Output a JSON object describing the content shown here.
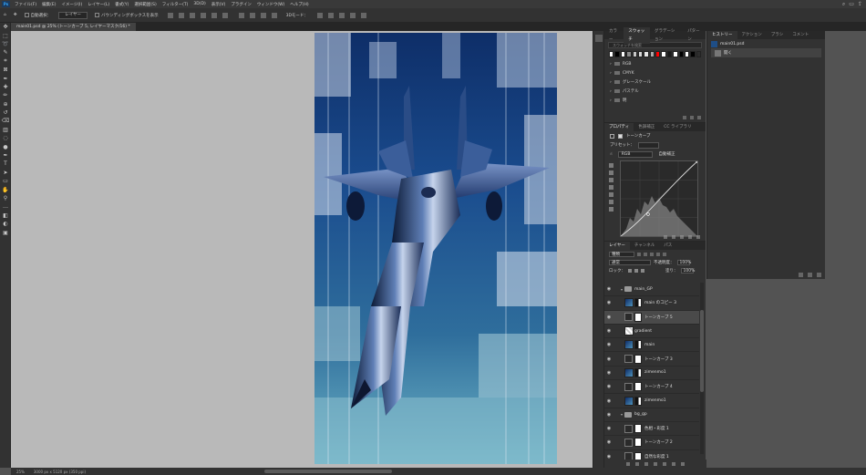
{
  "menubar": {
    "app_icon": "Ps",
    "items": [
      "ファイル(F)",
      "編集(E)",
      "イメージ(I)",
      "レイヤー(L)",
      "書式(Y)",
      "選択範囲(S)",
      "フィルター(T)",
      "3D(D)",
      "表示(V)",
      "プラグイン",
      "ウィンドウ(W)",
      "ヘルプ(H)"
    ],
    "right_icons": [
      "search-icon",
      "workspace-icon",
      "share-icon"
    ]
  },
  "options": {
    "auto_select_label": "自動選択：",
    "auto_select_value": "レイヤー",
    "bbox_label": "バウンディングボックスを表示",
    "mode_3d": "3Dモード："
  },
  "document": {
    "tab_title": "main01.psd @ 25% (トーンカーブ 5, レイヤーマスク/16) *",
    "zoom": "25%",
    "dimensions": "3000 px x 5120 px (350 ppi)"
  },
  "swatches": {
    "tabs": [
      "カラー",
      "スウォッチ",
      "グラデーション",
      "パターン"
    ],
    "active_tab": "スウォッチ",
    "search_placeholder": "スウォッチを検索",
    "colors": [
      "#ffffff",
      "#000000",
      "#ffffff",
      "#8c8c8c",
      "#c8c8c8",
      "#d7d7d7",
      "#e6e6e6",
      "#aaaaaa",
      "#ff0000",
      "#ffffff",
      "#1a1a1a",
      "#ffffff",
      "#000000",
      "#ffffff",
      "#000000",
      "#2e2e2e"
    ],
    "groups": [
      "RGB",
      "CMYK",
      "グレースケール",
      "パステル",
      "明"
    ]
  },
  "history": {
    "tabs": [
      "ヒストリー",
      "アクション",
      "ブラシ",
      "コメント"
    ],
    "active_tab": "ヒストリー",
    "snapshot": "main01.psd",
    "items": [
      "開く"
    ]
  },
  "properties": {
    "tabs": [
      "プロパティ",
      "色調補正",
      "CC ライブラリ"
    ],
    "active_tab": "プロパティ",
    "title": "トーンカーブ",
    "preset_label": "プリセット：",
    "channel": "RGB",
    "auto_button": "自動補正"
  },
  "layers": {
    "tabs": [
      "レイヤー",
      "チャンネル",
      "パス"
    ],
    "active_tab": "レイヤー",
    "filter": "種類",
    "blend_mode": "通常",
    "opacity_label": "不透明度：",
    "opacity": "100%",
    "lock_label": "ロック：",
    "fill_label": "塗り：",
    "fill": "100%",
    "list": [
      {
        "name": "main_GP",
        "kind": "group",
        "indent": 0,
        "selected": false
      },
      {
        "name": "main のコピー 3",
        "kind": "pixel",
        "indent": 1,
        "selected": false
      },
      {
        "name": "トーンカーブ 5",
        "kind": "curve",
        "indent": 1,
        "selected": true
      },
      {
        "name": "gradient",
        "kind": "grad",
        "indent": 1,
        "selected": false
      },
      {
        "name": "main",
        "kind": "pixel",
        "indent": 1,
        "selected": false
      },
      {
        "name": "トーンカーブ 3",
        "kind": "curve",
        "indent": 1,
        "selected": false
      },
      {
        "name": "zimenmo1",
        "kind": "pixel",
        "indent": 1,
        "selected": false
      },
      {
        "name": "トーンカーブ 4",
        "kind": "curve",
        "indent": 1,
        "selected": false
      },
      {
        "name": "zimenmo1",
        "kind": "pixel",
        "indent": 1,
        "selected": false
      },
      {
        "name": "bg_gp",
        "kind": "group",
        "indent": 0,
        "selected": false
      },
      {
        "name": "色相・彩度 1",
        "kind": "hue",
        "indent": 1,
        "selected": false
      },
      {
        "name": "トーンカーブ 2",
        "kind": "curve",
        "indent": 1,
        "selected": false
      },
      {
        "name": "自然な彩度 1",
        "kind": "vibrance",
        "indent": 1,
        "selected": false
      }
    ]
  },
  "tools": [
    "move-icon",
    "marquee-icon",
    "lasso-icon",
    "quick-select-icon",
    "crop-icon",
    "frame-icon",
    "eyedropper-icon",
    "healing-icon",
    "brush-icon",
    "stamp-icon",
    "history-brush-icon",
    "eraser-icon",
    "gradient-icon",
    "blur-icon",
    "dodge-icon",
    "pen-icon",
    "type-icon",
    "path-select-icon",
    "shape-icon",
    "hand-icon",
    "zoom-icon",
    "more-icon",
    "colors-icon",
    "quickmask-icon",
    "screen-mode-icon"
  ]
}
